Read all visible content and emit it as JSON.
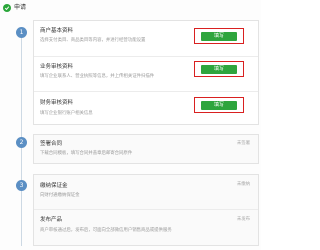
{
  "header": {
    "title": "申请"
  },
  "steps": [
    "1",
    "2",
    "3"
  ],
  "section1": {
    "rows": [
      {
        "title": "商户基本资料",
        "desc": "选择支付类目、商品类目等内容，并进行经营功能设置",
        "button": "填写"
      },
      {
        "title": "业务审核资料",
        "desc": "填写企业联系人、营业执照等信息，并上传相关证件扫描件",
        "button": "填写"
      },
      {
        "title": "财务审核资料",
        "desc": "填写企业银行账户相关信息",
        "button": "填写"
      }
    ]
  },
  "section2": {
    "title": "签署合同",
    "desc": "下载合同模板，填写合同并盖章后邮寄合同原件",
    "status": "未签署"
  },
  "section3": {
    "rows": [
      {
        "title": "缴纳保证金",
        "desc": "向财付通缴纳保证金",
        "status": "未缴纳"
      },
      {
        "title": "发布产品",
        "desc": "商户审核通过后，发布后，可面向全部微信用户销售商品或提供服务",
        "status": "未发布"
      }
    ]
  },
  "colors": {
    "accent_green": "#2ea53d",
    "highlight_red": "#d92020",
    "step_blue": "#5b8fc4"
  }
}
